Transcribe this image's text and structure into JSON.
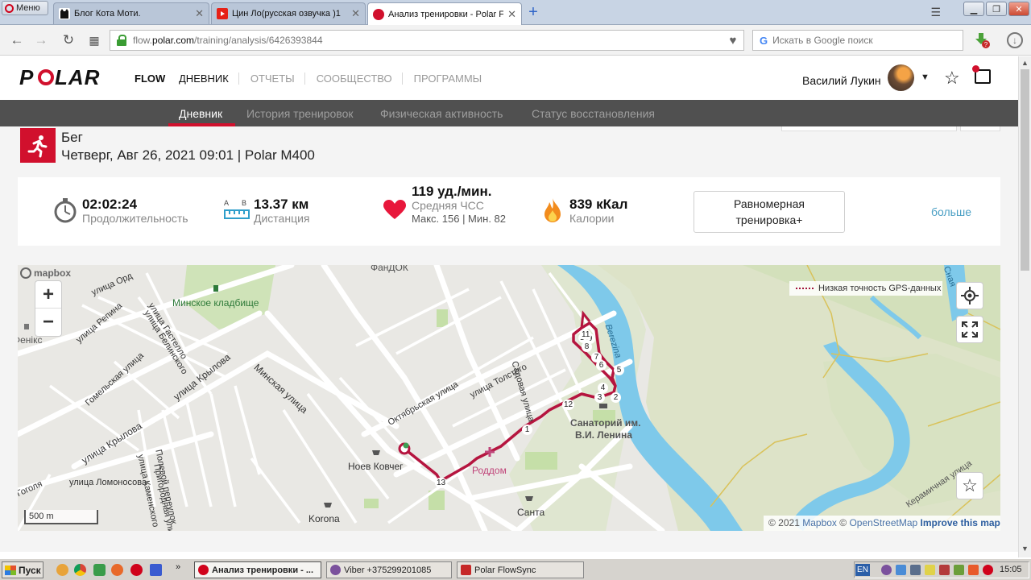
{
  "browser": {
    "menu_label": "Меню",
    "tabs": [
      {
        "title": "Блог Кота Моти.",
        "icon": "cat-icon"
      },
      {
        "title": "Цин Ло(русская озвучка )1",
        "icon": "youtube-icon"
      },
      {
        "title": "Анализ тренировки - Polar F",
        "icon": "polar-icon"
      }
    ],
    "url_prefix": "flow.",
    "url_domain": "polar.com",
    "url_path": "/training/analysis/6426393844",
    "search_placeholder": "Искать в Google поиск"
  },
  "header": {
    "logo_text": "POLAR",
    "flow_label": "FLOW",
    "nav": [
      "ДНЕВНИК",
      "ОТЧЕТЫ",
      "СООБЩЕСТВО",
      "ПРОГРАММЫ"
    ],
    "user_name": "Василий Лукин"
  },
  "subnav": [
    "Дневник",
    "История тренировок",
    "Физическая активность",
    "Статус восстановления"
  ],
  "activity": {
    "sport": "Бег",
    "date_line": "Четверг, Авг 26, 2021 09:01 | Polar M400"
  },
  "stats": {
    "duration_value": "02:02:24",
    "duration_label": "Продолжительность",
    "ab_a": "A",
    "ab_b": "B",
    "distance_value": "13.37 км",
    "distance_label": "Дистанция",
    "hr_value": "119 уд./мин.",
    "hr_label": "Средняя ЧСС",
    "hr_minmax": "Макс. 156 | Мин. 82",
    "calories_value": "839 кКал",
    "calories_label": "Калории",
    "training_benefit": "Равномерная тренировка+",
    "more_label": "больше"
  },
  "map": {
    "mapbox_label": "mapbox",
    "legend": "Низкая точность GPS-данных",
    "scale": "500 m",
    "attrib_copy": "© 2021",
    "attrib_mapbox": "Mapbox",
    "attrib_sep": "©",
    "attrib_osm": "OpenStreetMap",
    "attrib_improve": "Improve this map",
    "labels": {
      "fandok": "ФанДОК",
      "minsk_cemetery": "Минское кладбище",
      "phoenix": "Фенікс",
      "minsk_street": "Минская улица",
      "repina": "улица Репина",
      "gastello": "улица Гастелло",
      "belinskogo": "улица Белинского",
      "gomelskaya": "Гомельская улица",
      "krylova1": "улица Крылова",
      "krylova2": "улица Крылова",
      "oktyabrskaya": "Октябрьская улица",
      "tolstogo": "улица Толстого",
      "sadovaya": "Садовая улица",
      "polevoi": "Полевой переулок",
      "prigorodnaya": "Пригородная улица",
      "kamenskogo": "улица Каменского",
      "lomonosova": "улица Ломоносова",
      "gogolya": "Гоголя",
      "noev": "Ноев Ковчег",
      "roddom": "Роддом",
      "santa": "Санта",
      "korona": "Korona",
      "sanatorium1": "Санаторий им.",
      "sanatorium2": "В.И. Ленина",
      "berezina": "Berezina",
      "keramichnaya": "Керамичная улица",
      "snaya": "Сная",
      "ord": "улица Орд"
    },
    "km_markers": [
      "1",
      "2",
      "3",
      "4",
      "5",
      "6",
      "7",
      "8",
      "9",
      "10",
      "11",
      "12",
      "13"
    ]
  },
  "taskbar": {
    "start_label": "Пуск",
    "tasks": [
      "Анализ тренировки - ...",
      "Viber +375299201085",
      "Polar FlowSync"
    ],
    "lang": "EN",
    "clock": "15:05"
  },
  "colors": {
    "polar_red": "#d1102d",
    "route": "#b5153f",
    "water": "#7ec9ea",
    "green": "#c8e0b0",
    "link": "#4a9fc4"
  }
}
